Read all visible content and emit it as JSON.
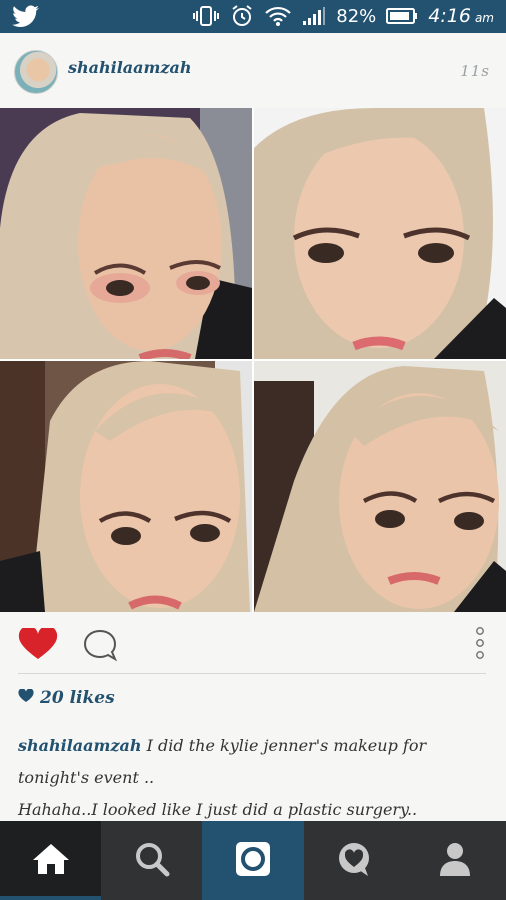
{
  "status_bar": {
    "battery": "82%",
    "time": "4:16",
    "ampm": "am"
  },
  "post": {
    "username": "shahilaamzah",
    "timestamp": "11s",
    "likes": "20 likes",
    "caption_user": "shahilaamzah",
    "caption_line1": "I did the kylie jenner's makeup for tonight's event ..",
    "caption_line2": "Hahaha..I looked like I just did a plastic surgery.."
  },
  "colors": {
    "accent": "#235170",
    "heart": "#d8232a",
    "nav_bg": "#303234"
  },
  "icons": {
    "status": [
      "twitter-icon",
      "vibrate-icon",
      "alarm-icon",
      "wifi-icon",
      "signal-icon",
      "battery-icon"
    ],
    "actions": [
      "heart-icon",
      "comment-icon",
      "more-vertical-icon"
    ],
    "nav": [
      "home-icon",
      "search-icon",
      "camera-icon",
      "activity-icon",
      "profile-icon"
    ]
  }
}
